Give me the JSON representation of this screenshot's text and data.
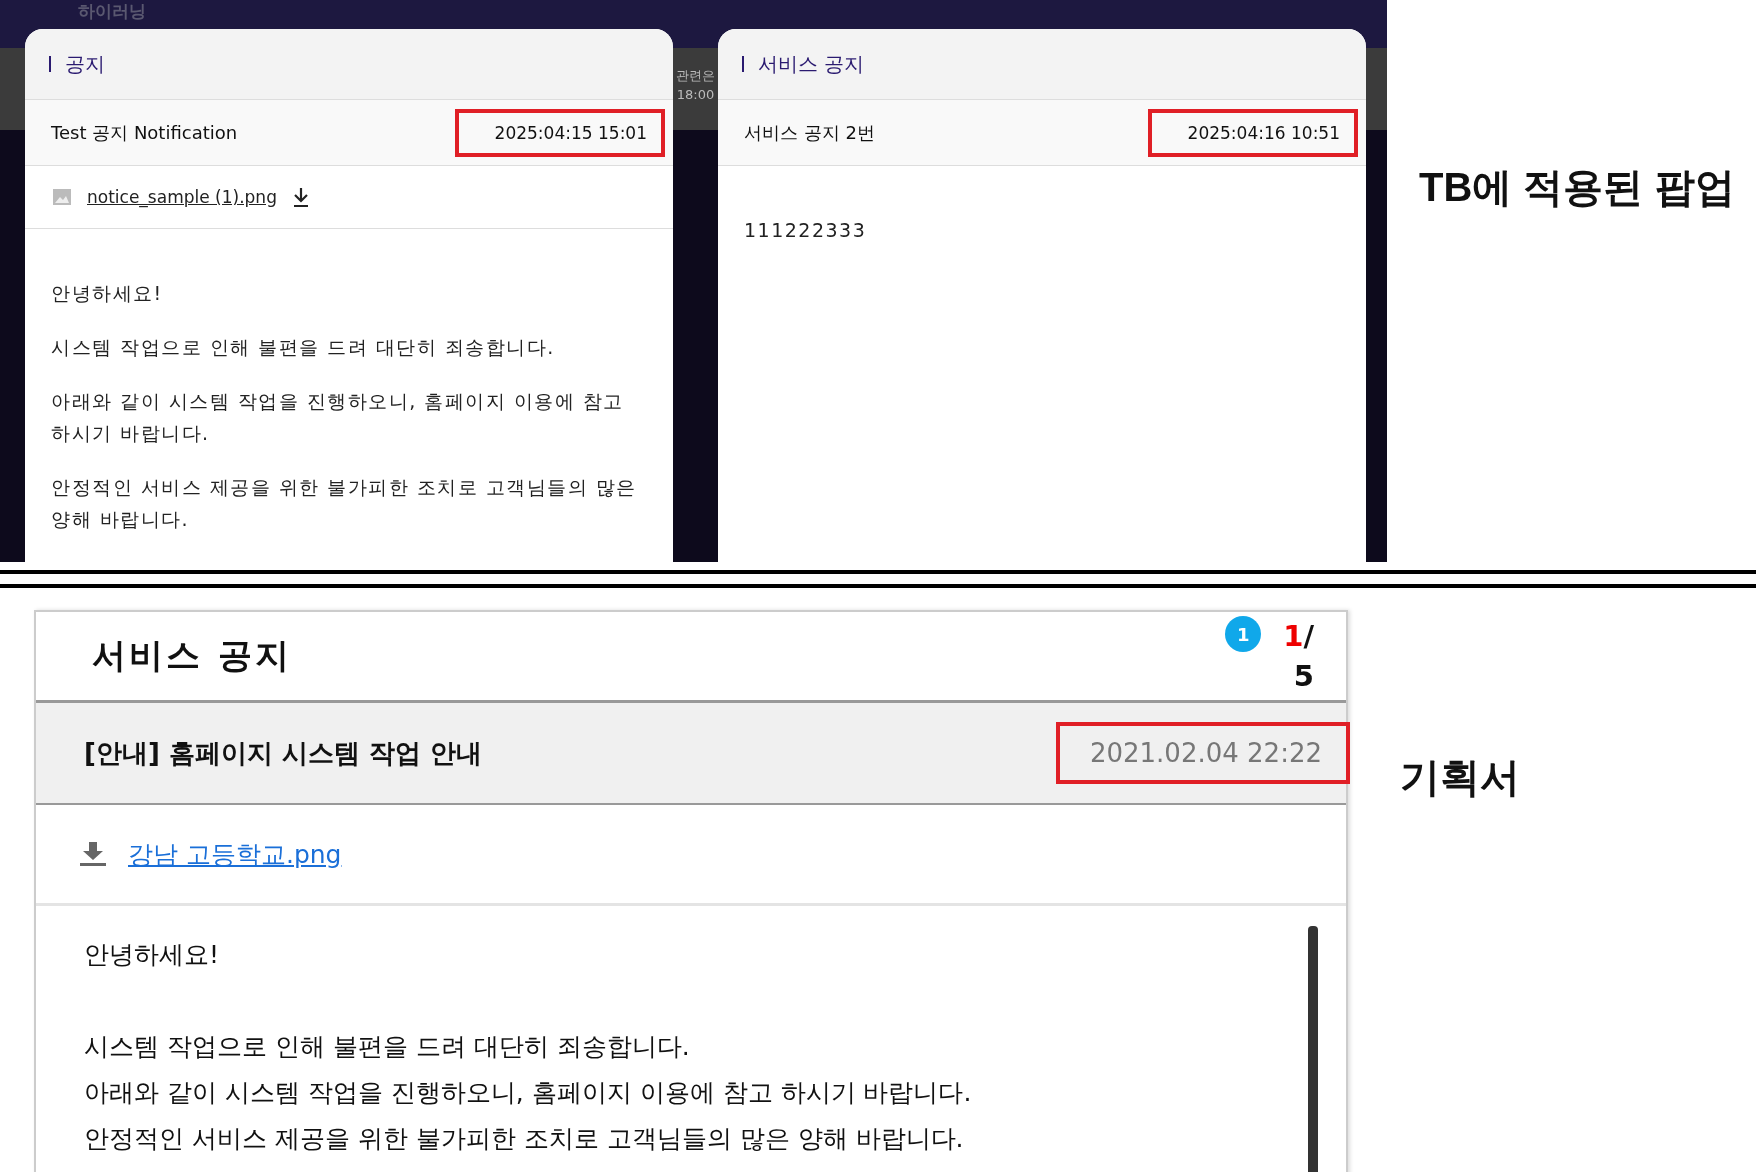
{
  "top_panel": {
    "brand": "하이러닝",
    "background_texts": [
      "관련은",
      "18:00"
    ],
    "popups": [
      {
        "title": "공지",
        "subject": "Test 공지 Notification",
        "date": "2025:04:15 15:01",
        "attachment": "notice_sample (1).png",
        "body": [
          "안녕하세요!",
          "시스템 작업으로 인해 불편을 드려 대단히 죄송합니다.",
          "아래와 같이 시스템 작업을 진행하오니, 홈페이지 이용에 참고 하시기 바랍니다.",
          "안정적인 서비스 제공을 위한 불가피한 조치로 고객님들의 많은 양해 바랍니다."
        ]
      },
      {
        "title": "서비스 공지",
        "subject": "서비스 공지 2번",
        "date": "2025:04:16 10:51",
        "body": [
          "111222333"
        ]
      }
    ],
    "annotation": "TB에 적용된 팝업"
  },
  "bottom_panel": {
    "title": "서비스 공지",
    "badge": "1",
    "page_current": "1",
    "page_separator": "/",
    "page_total": "5",
    "subject": "[안내] 홈페이지 시스템 작업 안내",
    "date": "2021.02.04 22:22",
    "attachment": "강남 고등학교.png",
    "body": [
      "안녕하세요!",
      "시스템 작업으로 인해 불편을 드려 대단히 죄송합니다.",
      "아래와 같이 시스템 작업을 진행하오니, 홈페이지 이용에 참고 하시기 바랍니다.",
      "안정적인 서비스 제공을 위한 불가피한 조치로 고객님들의 많은 양해 바랍니다."
    ],
    "annotation": "기획서"
  }
}
